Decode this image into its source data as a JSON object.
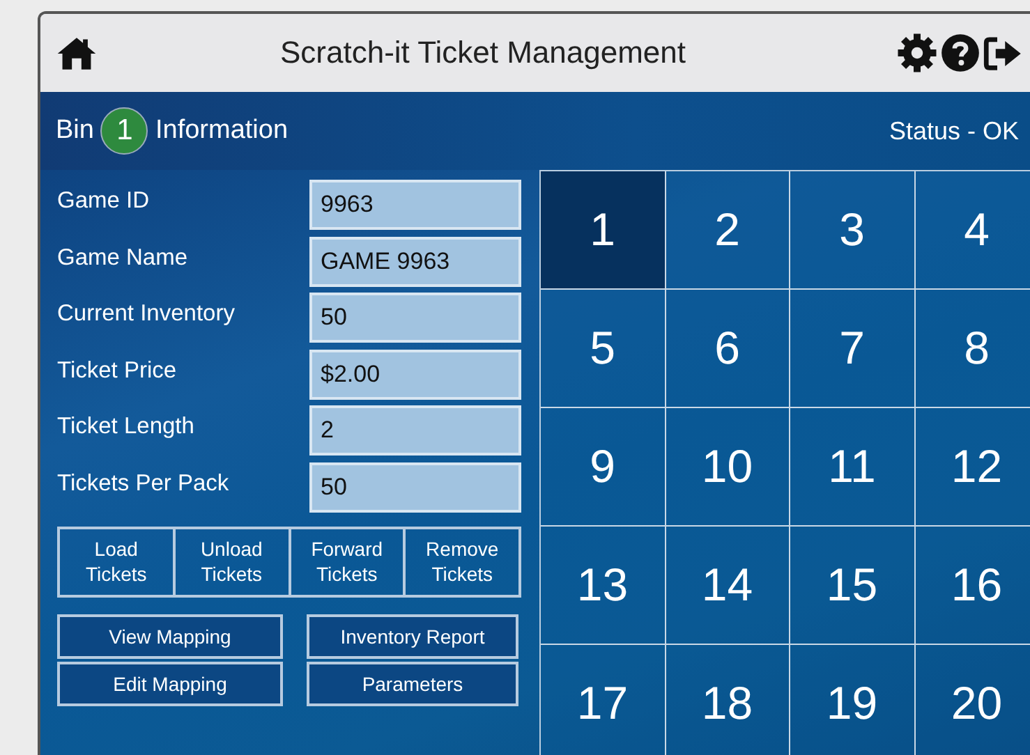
{
  "window": {
    "title": "Scratch-it Ticket Management"
  },
  "bin_bar": {
    "prefix": "Bin",
    "bin_number": "1",
    "suffix": "Information",
    "status": "Status - OK"
  },
  "fields": [
    {
      "label": "Game ID",
      "value": "9963"
    },
    {
      "label": "Game Name",
      "value": "GAME 9963"
    },
    {
      "label": "Current Inventory",
      "value": "50"
    },
    {
      "label": "Ticket Price",
      "value": "$2.00"
    },
    {
      "label": "Ticket Length",
      "value": "2"
    },
    {
      "label": "Tickets Per Pack",
      "value": "50"
    }
  ],
  "ticket_buttons": [
    {
      "line1": "Load",
      "line2": "Tickets"
    },
    {
      "line1": "Unload",
      "line2": "Tickets"
    },
    {
      "line1": "Forward",
      "line2": "Tickets"
    },
    {
      "line1": "Remove",
      "line2": "Tickets"
    }
  ],
  "action_buttons": [
    "View Mapping",
    "Inventory Report",
    "Edit Mapping",
    "Parameters"
  ],
  "bins": [
    {
      "label": "1",
      "selected": true
    },
    {
      "label": "2",
      "selected": false
    },
    {
      "label": "3",
      "selected": false
    },
    {
      "label": "4",
      "selected": false
    },
    {
      "label": "5",
      "selected": false
    },
    {
      "label": "6",
      "selected": false
    },
    {
      "label": "7",
      "selected": false
    },
    {
      "label": "8",
      "selected": false
    },
    {
      "label": "9",
      "selected": false
    },
    {
      "label": "10",
      "selected": false
    },
    {
      "label": "11",
      "selected": false
    },
    {
      "label": "12",
      "selected": false
    },
    {
      "label": "13",
      "selected": false
    },
    {
      "label": "14",
      "selected": false
    },
    {
      "label": "15",
      "selected": false
    },
    {
      "label": "16",
      "selected": false
    },
    {
      "label": "17",
      "selected": false
    },
    {
      "label": "18",
      "selected": false
    },
    {
      "label": "19",
      "selected": false
    },
    {
      "label": "20",
      "selected": false
    }
  ]
}
